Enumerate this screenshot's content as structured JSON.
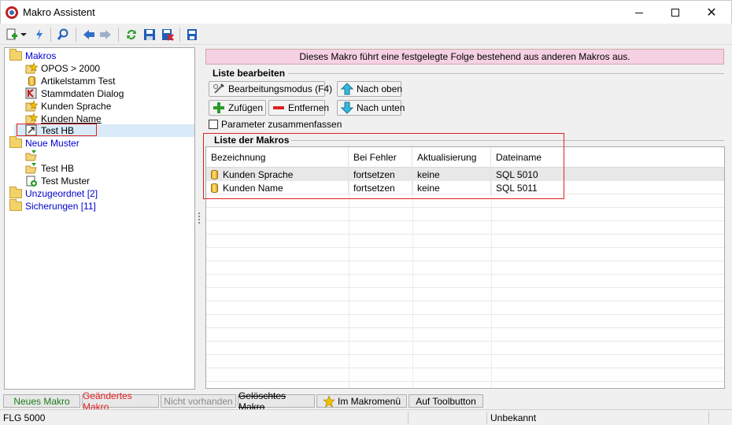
{
  "window": {
    "title": "Makro Assistent"
  },
  "toolbar": {
    "icons": [
      "new-macro-icon",
      "dropdown-arrow-icon",
      "run-icon",
      "search-icon",
      "back-icon",
      "forward-icon",
      "refresh-icon",
      "save-icon",
      "delete-icon",
      "export-icon"
    ]
  },
  "tree": {
    "items": [
      {
        "label": "Makros",
        "type": "group"
      },
      {
        "label": "OPOS > 2000",
        "type": "item"
      },
      {
        "label": "Artikelstamm Test",
        "type": "item"
      },
      {
        "label": "Stammdaten Dialog",
        "type": "item"
      },
      {
        "label": "Kunden Sprache",
        "type": "item"
      },
      {
        "label": "Kunden Name",
        "type": "item"
      },
      {
        "label": "Test HB",
        "type": "item"
      },
      {
        "label": "Neue Muster",
        "type": "group"
      },
      {
        "label": "",
        "type": "item"
      },
      {
        "label": "Test HB",
        "type": "item"
      },
      {
        "label": "Test Muster",
        "type": "item"
      },
      {
        "label": "Unzugeordnet [2]",
        "type": "group"
      },
      {
        "label": "Sicherungen [11]",
        "type": "group"
      }
    ]
  },
  "info": {
    "text": "Dieses Makro führt eine festgelegte Folge bestehend aus anderen Makros aus."
  },
  "edit_list": {
    "title": "Liste bearbeiten",
    "mode_button": "Bearbeitungsmodus (F4)",
    "add_button": "Zufügen",
    "remove_button": "Entfernen",
    "up_button": "Nach oben",
    "down_button": "Nach unten",
    "combine_checkbox": "Parameter zusammenfassen"
  },
  "macro_list": {
    "title": "Liste der Makros",
    "columns": [
      "Bezeichnung",
      "Bei Fehler",
      "Aktualisierung",
      "Dateiname"
    ],
    "rows": [
      [
        "Kunden Sprache",
        "fortsetzen",
        "keine",
        "SQL 5010"
      ],
      [
        "Kunden Name",
        "fortsetzen",
        "keine",
        "SQL 5011"
      ]
    ]
  },
  "legend": {
    "items": [
      {
        "label": "Neues Makro",
        "color": "#1a7a1a"
      },
      {
        "label": "Geändertes Makro",
        "color": "#e02020"
      },
      {
        "label": "Nicht vorhanden",
        "color": "#8a8a8a"
      },
      {
        "label": "Gelöschtes Makro",
        "color": "#000000"
      },
      {
        "label": "Im Makromenü",
        "color": "#000000"
      },
      {
        "label": "Auf Toolbutton",
        "color": "#000000"
      }
    ]
  },
  "status": {
    "left": "FLG 5000",
    "right": "Unbekannt"
  }
}
